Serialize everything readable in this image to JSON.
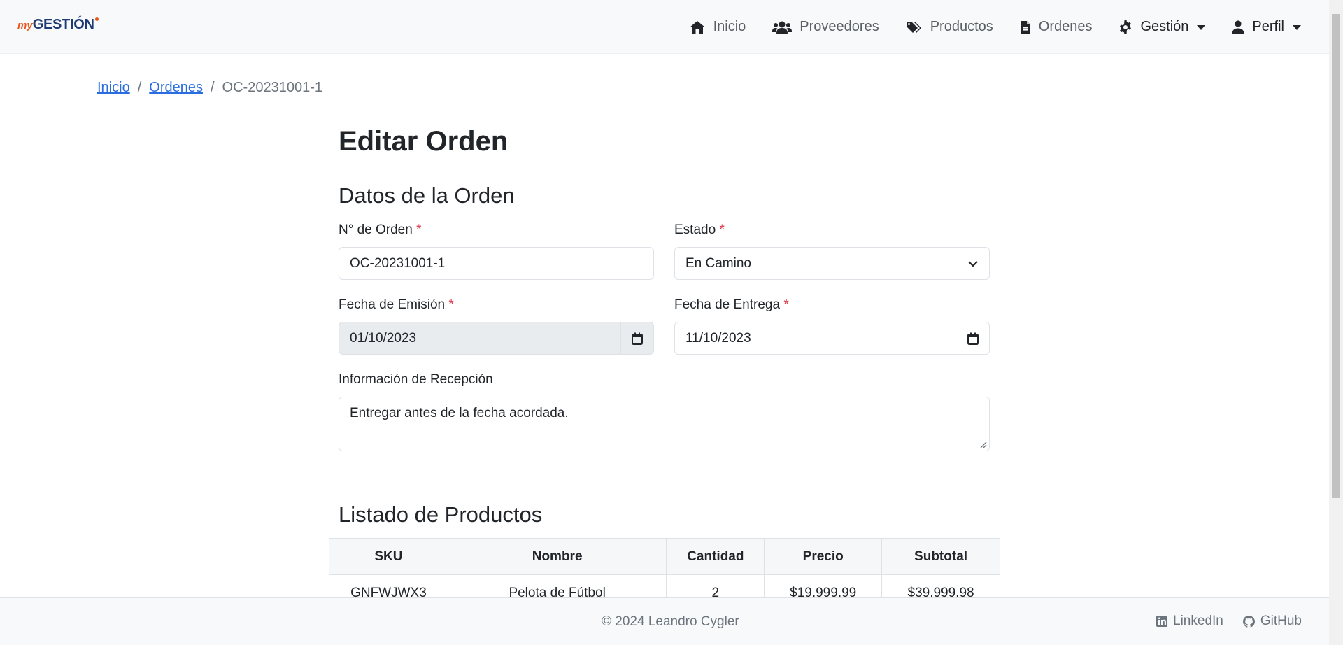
{
  "navbar": {
    "brand": {
      "prefix": "my",
      "name": "GESTIÓN"
    },
    "items": [
      {
        "label": "Inicio",
        "icon": "home-icon"
      },
      {
        "label": "Proveedores",
        "icon": "users-icon"
      },
      {
        "label": "Productos",
        "icon": "tags-icon"
      },
      {
        "label": "Ordenes",
        "icon": "file-icon"
      },
      {
        "label": "Gestión",
        "icon": "gear-icon",
        "dropdown": true
      },
      {
        "label": "Perfil",
        "icon": "user-icon",
        "dropdown": true
      }
    ]
  },
  "breadcrumb": {
    "items": [
      {
        "label": "Inicio"
      },
      {
        "label": "Ordenes"
      }
    ],
    "current": "OC-20231001-1"
  },
  "page": {
    "title": "Editar Orden",
    "section_order": "Datos de la Orden",
    "section_products": "Listado de Productos"
  },
  "form": {
    "order_number": {
      "label": "N° de Orden",
      "value": "OC-20231001-1",
      "required_mark": "*"
    },
    "status": {
      "label": "Estado",
      "value": "En Camino",
      "required_mark": "*"
    },
    "issue_date": {
      "label": "Fecha de Emisión",
      "value": "01/10/2023",
      "required_mark": "*"
    },
    "delivery_date": {
      "label": "Fecha de Entrega",
      "value": "11/10/2023",
      "required_mark": "*"
    },
    "reception_info": {
      "label": "Información de Recepción",
      "value": "Entregar antes de la fecha acordada."
    }
  },
  "table": {
    "headers": [
      "SKU",
      "Nombre",
      "Cantidad",
      "Precio",
      "Subtotal"
    ],
    "rows": [
      [
        "GNFWJWX3",
        "Pelota de Fútbol",
        "2",
        "$19,999.99",
        "$39,999.98"
      ]
    ]
  },
  "footer": {
    "copyright": "© 2024 Leandro Cygler",
    "links": [
      {
        "label": "LinkedIn",
        "icon": "linkedin-icon"
      },
      {
        "label": "GitHub",
        "icon": "github-icon"
      }
    ]
  },
  "colors": {
    "link": "#2a6de0",
    "required": "#dc3545",
    "brand_orange": "#e8571c",
    "brand_blue": "#1f3b73"
  }
}
